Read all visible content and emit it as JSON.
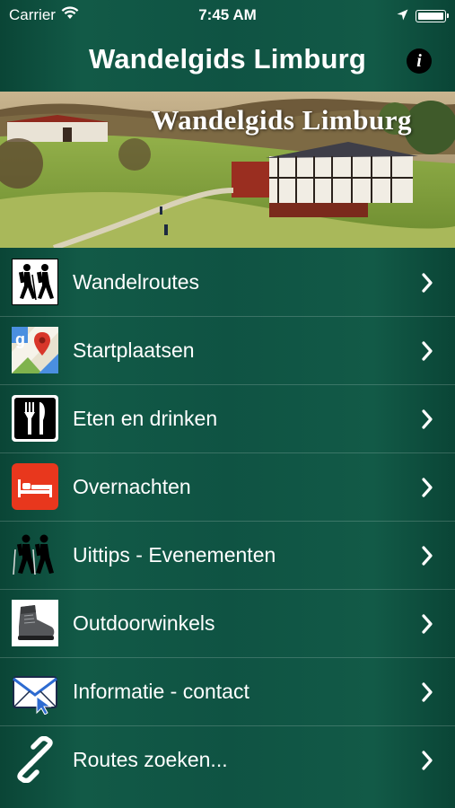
{
  "status_bar": {
    "carrier": "Carrier",
    "time": "7:45 AM"
  },
  "nav": {
    "title": "Wandelgids Limburg",
    "info_icon": "info-icon"
  },
  "banner": {
    "title": "Wandelgids Limburg"
  },
  "menu": {
    "items": [
      {
        "label": "Wandelroutes",
        "icon": "hikers-icon"
      },
      {
        "label": "Startplaatsen",
        "icon": "map-pin-icon"
      },
      {
        "label": "Eten en drinken",
        "icon": "fork-knife-icon"
      },
      {
        "label": "Overnachten",
        "icon": "bed-icon"
      },
      {
        "label": "Uittips - Evenementen",
        "icon": "hikers-icon"
      },
      {
        "label": "Outdoorwinkels",
        "icon": "boot-icon"
      },
      {
        "label": "Informatie - contact",
        "icon": "mail-icon"
      },
      {
        "label": "Routes zoeken...",
        "icon": "link-icon"
      }
    ]
  },
  "colors": {
    "background": "#0f5343",
    "text": "#ffffff",
    "bed_icon_bg": "#e8371d"
  }
}
